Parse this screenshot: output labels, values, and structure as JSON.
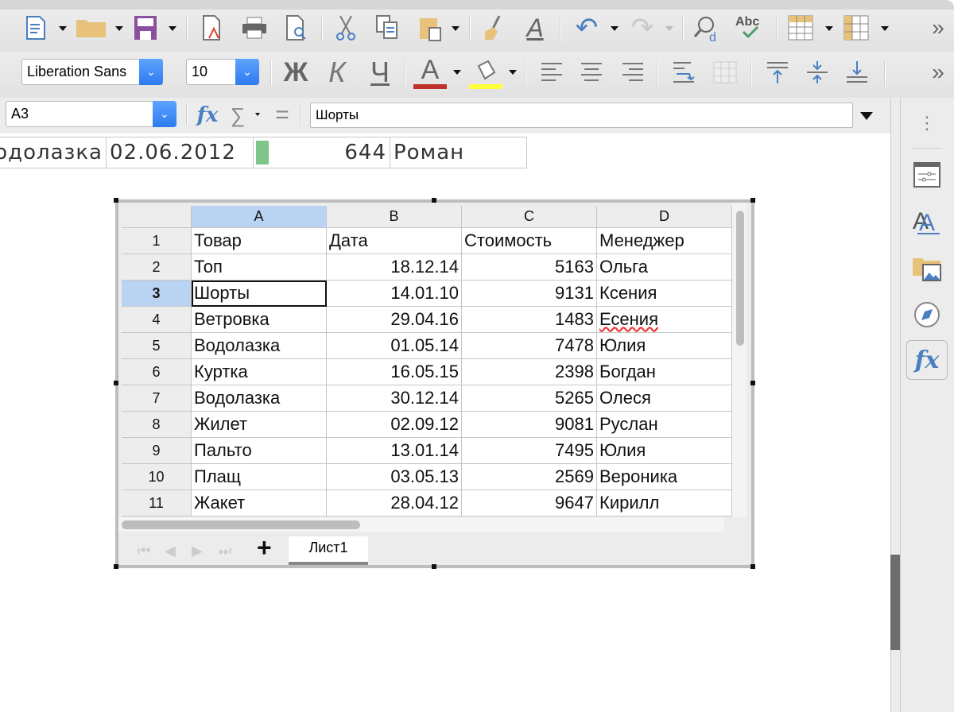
{
  "toolbar1": {
    "icons": [
      "new-document-icon",
      "open-folder-icon",
      "save-icon",
      "export-pdf-icon",
      "print-icon",
      "print-preview-icon",
      "cut-icon",
      "copy-icon",
      "paste-icon",
      "clone-formatting-icon",
      "clear-formatting-icon",
      "undo-icon",
      "redo-icon",
      "find-replace-icon",
      "spelling-icon",
      "row-icon",
      "column-icon"
    ],
    "more": "»"
  },
  "toolbar2": {
    "font_name": "Liberation Sans",
    "font_size": "10",
    "bold": "Ж",
    "italic": "К",
    "underline": "Ч",
    "font_color_glyph": "A",
    "font_color": "#c0302a",
    "highlight_color": "#ffff3a",
    "more": "»"
  },
  "formula_bar": {
    "name_box": "A3",
    "fx": "fx",
    "sum": "∑",
    "equals": "=",
    "content": "Шорты"
  },
  "background_row": {
    "cells": [
      "одолазка",
      "02.06.2012",
      "644",
      "Роман"
    ],
    "bar_color": "#7dc58a"
  },
  "embedded_sheet": {
    "columns": [
      "A",
      "B",
      "C",
      "D"
    ],
    "rows": [
      [
        "1",
        "Товар",
        "Дата",
        "Стоимость",
        "Менеджер"
      ],
      [
        "2",
        "Топ",
        "18.12.14",
        "5163",
        "Ольга"
      ],
      [
        "3",
        "Шорты",
        "14.01.10",
        "9131",
        "Ксения"
      ],
      [
        "4",
        "Ветровка",
        "29.04.16",
        "1483",
        "Есения"
      ],
      [
        "5",
        "Водолазка",
        "01.05.14",
        "7478",
        "Юлия"
      ],
      [
        "6",
        "Куртка",
        "16.05.15",
        "2398",
        "Богдан"
      ],
      [
        "7",
        "Водолазка",
        "30.12.14",
        "5265",
        "Олеся"
      ],
      [
        "8",
        "Жилет",
        "02.09.12",
        "9081",
        "Руслан"
      ],
      [
        "9",
        "Пальто",
        "13.01.14",
        "7495",
        "Юлия"
      ],
      [
        "10",
        "Плащ",
        "03.05.13",
        "2569",
        "Вероника"
      ],
      [
        "11",
        "Жакет",
        "28.04.12",
        "9647",
        "Кирилл"
      ]
    ],
    "active_cell": "A3",
    "sheet_tab": "Лист1",
    "add_sheet": "+"
  },
  "sidebar": {
    "icons": [
      "more-options-icon",
      "properties-icon",
      "styles-icon",
      "gallery-icon",
      "navigator-icon",
      "functions-icon"
    ],
    "fx": "fx"
  }
}
